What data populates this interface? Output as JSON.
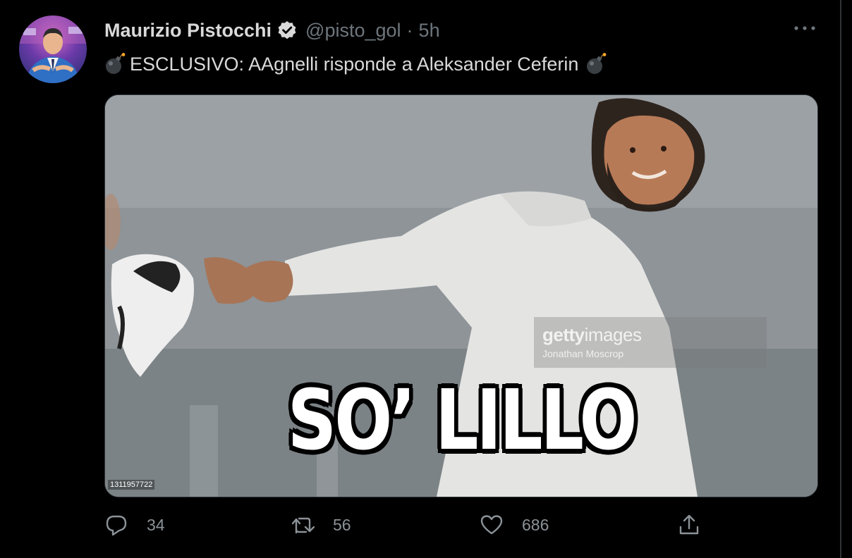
{
  "tweet": {
    "author_name": "Maurizio Pistocchi",
    "handle": "@pisto_gol",
    "separator": "·",
    "time": "5h",
    "text": "ESCLUSIVO: AAgnelli risponde a Aleksander Ceferin"
  },
  "media": {
    "caption": "SO’ LILLO",
    "watermark_brand_bold": "getty",
    "watermark_brand_light": "images",
    "watermark_credit": "Jonathan Moscrop",
    "stock_id": "1311957722"
  },
  "actions": {
    "reply_count": "34",
    "retweet_count": "56",
    "like_count": "686"
  },
  "icons": {
    "verified": "verified-badge-icon",
    "more": "more-icon",
    "bomb": "bomb-emoji-icon",
    "reply": "reply-icon",
    "retweet": "retweet-icon",
    "like": "heart-icon",
    "share": "share-icon"
  },
  "colors": {
    "background": "#000000",
    "text_primary": "#d9d9d9",
    "text_secondary": "#6e767d",
    "border": "#2f3336"
  }
}
